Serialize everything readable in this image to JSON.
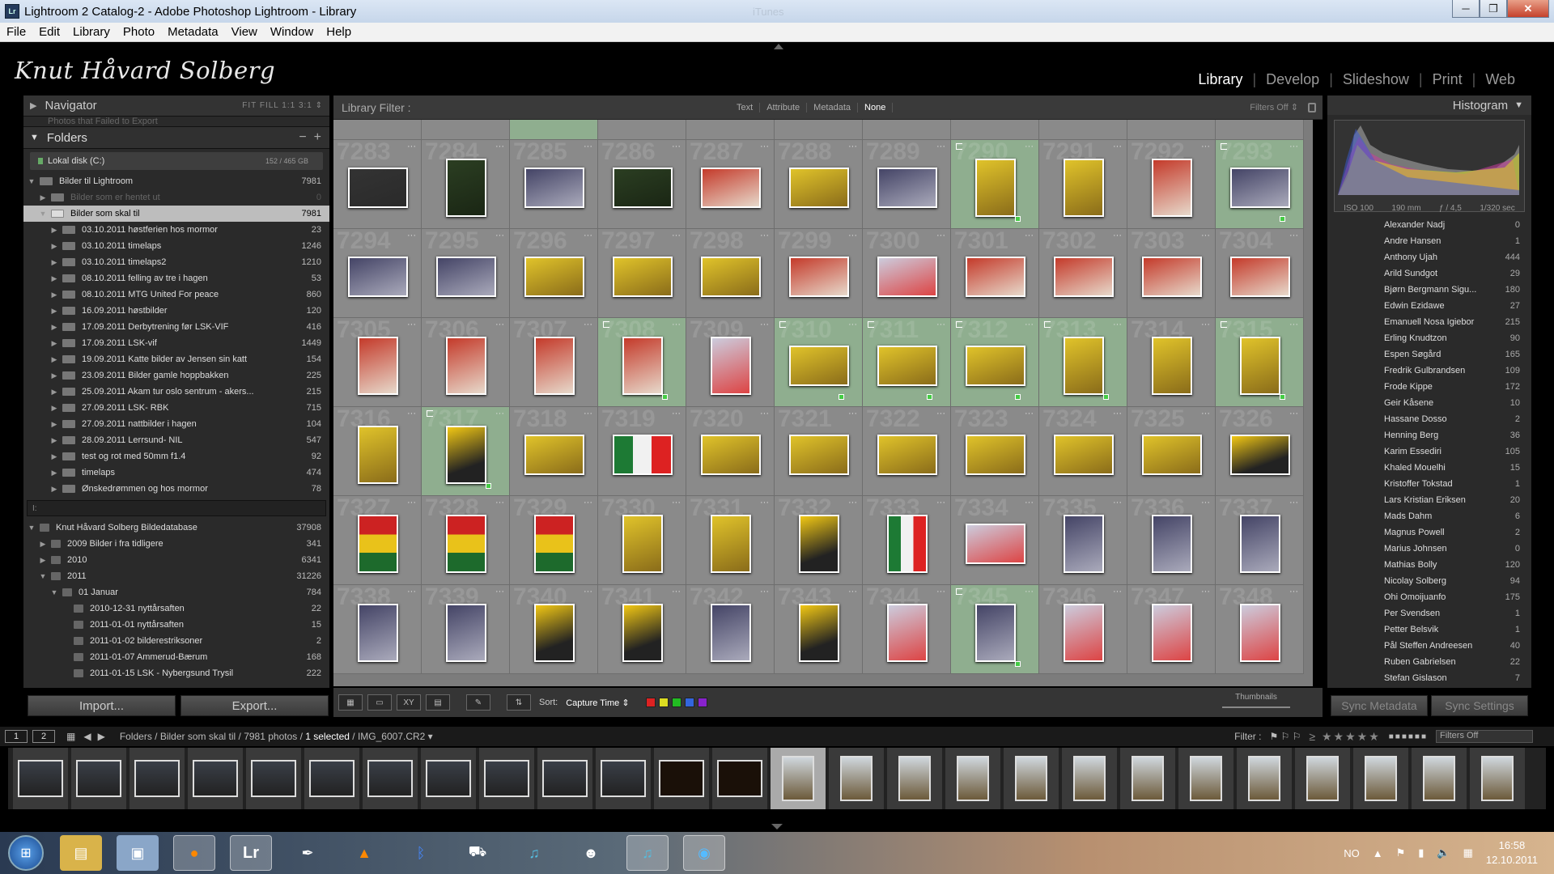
{
  "window": {
    "title": "Lightroom 2 Catalog-2 - Adobe Photoshop Lightroom - Library",
    "icon_text": "Lr",
    "ghost_text": "iTunes"
  },
  "menu": [
    "File",
    "Edit",
    "Library",
    "Photo",
    "Metadata",
    "View",
    "Window",
    "Help"
  ],
  "identity_plate": "Knut Håvard Solberg",
  "modules": [
    "Library",
    "Develop",
    "Slideshow",
    "Print",
    "Web"
  ],
  "navigator": {
    "title": "Navigator",
    "options": "FIT   FILL   1:1   3:1 ⇕"
  },
  "collapsed_text": "Photos that Failed to Export",
  "folders": {
    "title": "Folders",
    "volume": {
      "name": "Lokal disk (C:)",
      "capacity": "152 / 465 GB"
    },
    "items": [
      {
        "name": "Bilder til Lightroom",
        "count": "7981",
        "level": 0,
        "state": ""
      },
      {
        "name": "Bilder som er hentet ut",
        "count": "0",
        "level": 1,
        "state": "dim"
      },
      {
        "name": "Bilder som skal til",
        "count": "7981",
        "level": 1,
        "state": "sel"
      },
      {
        "name": "03.10.2011 høstferien hos mormor",
        "count": "23",
        "level": 2,
        "state": ""
      },
      {
        "name": "03.10.2011 timelaps",
        "count": "1246",
        "level": 2,
        "state": ""
      },
      {
        "name": "03.10.2011 timelaps2",
        "count": "1210",
        "level": 2,
        "state": ""
      },
      {
        "name": "08.10.2011 felling av tre i hagen",
        "count": "53",
        "level": 2,
        "state": ""
      },
      {
        "name": "08.10.2011 MTG United For peace",
        "count": "860",
        "level": 2,
        "state": ""
      },
      {
        "name": "16.09.2011 høstbilder",
        "count": "120",
        "level": 2,
        "state": ""
      },
      {
        "name": "17.09.2011 Derbytrening før LSK-VIF",
        "count": "416",
        "level": 2,
        "state": ""
      },
      {
        "name": "17.09.2011 LSK-vif",
        "count": "1449",
        "level": 2,
        "state": ""
      },
      {
        "name": "19.09.2011 Katte bilder av Jensen sin katt",
        "count": "154",
        "level": 2,
        "state": ""
      },
      {
        "name": "23.09.2011 Bilder gamle hoppbakken",
        "count": "225",
        "level": 2,
        "state": ""
      },
      {
        "name": "25.09.2011 Akam tur oslo sentrum - akers...",
        "count": "215",
        "level": 2,
        "state": ""
      },
      {
        "name": "27.09.2011 LSK- RBK",
        "count": "715",
        "level": 2,
        "state": ""
      },
      {
        "name": "27.09.2011 nattbilder i hagen",
        "count": "104",
        "level": 2,
        "state": ""
      },
      {
        "name": "28.09.2011 Lerrsund- NIL",
        "count": "547",
        "level": 2,
        "state": ""
      },
      {
        "name": "test og rot med 50mm f1.4",
        "count": "92",
        "level": 2,
        "state": ""
      },
      {
        "name": "timelaps",
        "count": "474",
        "level": 2,
        "state": ""
      },
      {
        "name": "Ønskedrømmen og hos mormor",
        "count": "78",
        "level": 2,
        "state": ""
      }
    ]
  },
  "divider_text": "I:",
  "collections": [
    {
      "name": "Knut Håvard Solberg Bildedatabase",
      "count": "37908",
      "level": 0,
      "tw": "▼"
    },
    {
      "name": "2009 Bilder i fra tidligere",
      "count": "341",
      "level": 1,
      "tw": "▶"
    },
    {
      "name": "2010",
      "count": "6341",
      "level": 1,
      "tw": "▶"
    },
    {
      "name": "2011",
      "count": "31226",
      "level": 1,
      "tw": "▼"
    },
    {
      "name": "01 Januar",
      "count": "784",
      "level": 2,
      "tw": "▼"
    },
    {
      "name": "2010-12-31 nyttårsaften",
      "count": "22",
      "level": 3,
      "tw": ""
    },
    {
      "name": "2011-01-01 nyttårsaften",
      "count": "15",
      "level": 3,
      "tw": ""
    },
    {
      "name": "2011-01-02 bilderestriksoner",
      "count": "2",
      "level": 3,
      "tw": ""
    },
    {
      "name": "2011-01-07 Ammerud-Bærum",
      "count": "168",
      "level": 3,
      "tw": ""
    },
    {
      "name": "2011-01-15 LSK - Nybergsund Trysil",
      "count": "222",
      "level": 3,
      "tw": ""
    }
  ],
  "import_label": "Import...",
  "export_label": "Export...",
  "filter": {
    "label": "Library Filter :",
    "tabs": [
      "Text",
      "Attribute",
      "Metadata",
      "None"
    ],
    "active": "None",
    "preset": "Filters Off ⇕"
  },
  "grid_numbers": [
    [
      "7283",
      "7284",
      "7285",
      "7286",
      "7287",
      "7288",
      "7289",
      "7290",
      "7291",
      "7292",
      "7293"
    ],
    [
      "7294",
      "7295",
      "7296",
      "7297",
      "7298",
      "7299",
      "7300",
      "7301",
      "7302",
      "7303",
      "7304"
    ],
    [
      "7305",
      "7306",
      "7307",
      "7308",
      "7309",
      "7310",
      "7311",
      "7312",
      "7313",
      "7314",
      "7315"
    ],
    [
      "7316",
      "7317",
      "7318",
      "7319",
      "7320",
      "7321",
      "7322",
      "7323",
      "7324",
      "7325",
      "7326"
    ],
    [
      "7327",
      "7328",
      "7329",
      "7330",
      "7331",
      "7332",
      "7333",
      "7334",
      "7335",
      "7336",
      "7337"
    ],
    [
      "7338",
      "7339",
      "7340",
      "7341",
      "7342",
      "7343",
      "7344",
      "7345",
      "7346",
      "7347",
      "7348"
    ]
  ],
  "toolbar": {
    "sort_label": "Sort:",
    "sort_value": "Capture Time ⇕",
    "thumbnails_label": "Thumbnails"
  },
  "histogram": {
    "title": "Histogram",
    "iso": "ISO 100",
    "focal": "190 mm",
    "aperture": "ƒ / 4,5",
    "shutter": "1/320 sec"
  },
  "people": [
    {
      "name": "Alexander Nadj",
      "count": "0"
    },
    {
      "name": "Andre Hansen",
      "count": "1"
    },
    {
      "name": "Anthony Ujah",
      "count": "444"
    },
    {
      "name": "Arild Sundgot",
      "count": "29"
    },
    {
      "name": "Bjørn Bergmann Sigu...",
      "count": "180"
    },
    {
      "name": "Edwin Ezidawe",
      "count": "27"
    },
    {
      "name": "Emanuell Nosa Igiebor",
      "count": "215"
    },
    {
      "name": "Erling Knudtzon",
      "count": "90"
    },
    {
      "name": "Espen Søgård",
      "count": "165"
    },
    {
      "name": "Fredrik Gulbrandsen",
      "count": "109"
    },
    {
      "name": "Frode Kippe",
      "count": "172"
    },
    {
      "name": "Geir Kåsene",
      "count": "10"
    },
    {
      "name": "Hassane Dosso",
      "count": "2"
    },
    {
      "name": "Henning Berg",
      "count": "36"
    },
    {
      "name": "Karim Essediri",
      "count": "105"
    },
    {
      "name": "Khaled Mouelhi",
      "count": "15"
    },
    {
      "name": "Kristoffer Tokstad",
      "count": "1"
    },
    {
      "name": "Lars Kristian Eriksen",
      "count": "20"
    },
    {
      "name": "Mads Dahm",
      "count": "6"
    },
    {
      "name": "Magnus Powell",
      "count": "2"
    },
    {
      "name": "Marius Johnsen",
      "count": "0"
    },
    {
      "name": "Mathias Bolly",
      "count": "120"
    },
    {
      "name": "Nicolay Solberg",
      "count": "94"
    },
    {
      "name": "Ohi Omoijuanfo",
      "count": "175"
    },
    {
      "name": "Per Svendsen",
      "count": "1"
    },
    {
      "name": "Petter Belsvik",
      "count": "1"
    },
    {
      "name": "Pål Steffen Andreesen",
      "count": "40"
    },
    {
      "name": "Ruben Gabrielsen",
      "count": "22"
    },
    {
      "name": "Stefan Gislason",
      "count": "7"
    }
  ],
  "sync_metadata_label": "Sync Metadata",
  "sync_settings_label": "Sync Settings",
  "breadcrumb": {
    "monitor1": "1",
    "monitor2": "2",
    "path": "Folders / Bilder som skal til / 7981 photos / ",
    "selected": "1 selected",
    "file": " / IMG_6007.CR2 ▾",
    "filter_label": "Filter :",
    "filter_value": "Filters Off"
  },
  "clock": {
    "time": "16:58",
    "date": "12.10.2011",
    "lang": "NO"
  },
  "colors": {
    "accent": "#8fae8f",
    "panel": "#2a2a2a",
    "grid": "#8a8a8a"
  }
}
